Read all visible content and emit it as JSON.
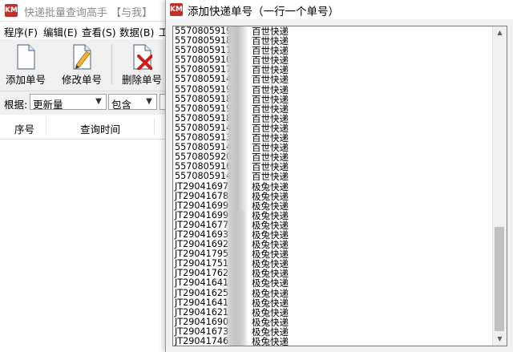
{
  "main_window": {
    "title": "快递批量查询高手 【与我】",
    "app_icon_text": "KM",
    "menu": [
      "程序(F)",
      "编辑(E)",
      "查看(S)",
      "数据(B)",
      "工"
    ],
    "toolbar": {
      "add_label": "添加单号",
      "edit_label": "修改单号",
      "delete_label": "删除单号"
    },
    "filter": {
      "label": "根据:",
      "field_value": "更新量",
      "match_value": "包含"
    },
    "table_columns": [
      "序号",
      "查询时间"
    ]
  },
  "dialog": {
    "title": "添加快递单号（一行一个单号）",
    "icon_text": "KM",
    "lines": [
      {
        "num": "5570805919",
        "carrier": "百世快递"
      },
      {
        "num": "5570805918",
        "carrier": "百世快递"
      },
      {
        "num": "5570805911",
        "carrier": "百世快递"
      },
      {
        "num": "5570805910",
        "carrier": "百世快递"
      },
      {
        "num": "5570805917",
        "carrier": "百世快递"
      },
      {
        "num": "5570805914",
        "carrier": "百世快递"
      },
      {
        "num": "5570805919",
        "carrier": "百世快递"
      },
      {
        "num": "5570805918",
        "carrier": "百世快递"
      },
      {
        "num": "5570805919",
        "carrier": "百世快递"
      },
      {
        "num": "5570805918",
        "carrier": "百世快递"
      },
      {
        "num": "5570805914",
        "carrier": "百世快递"
      },
      {
        "num": "5570805913",
        "carrier": "百世快递"
      },
      {
        "num": "5570805914",
        "carrier": "百世快递"
      },
      {
        "num": "5570805920",
        "carrier": "百世快递"
      },
      {
        "num": "5570805916",
        "carrier": "百世快递"
      },
      {
        "num": "5570805914",
        "carrier": "百世快递"
      },
      {
        "num": "JT29041697",
        "carrier": "极兔快递"
      },
      {
        "num": "JT29041678",
        "carrier": "极兔快递"
      },
      {
        "num": "JT29041699",
        "carrier": "极兔快递"
      },
      {
        "num": "JT29041699",
        "carrier": "极兔快递"
      },
      {
        "num": "JT29041677",
        "carrier": "极兔快递"
      },
      {
        "num": "JT29041693",
        "carrier": "极兔快递"
      },
      {
        "num": "JT29041692",
        "carrier": "极兔快递"
      },
      {
        "num": "JT29041795",
        "carrier": "极兔快递"
      },
      {
        "num": "JT29041751",
        "carrier": "极兔快递"
      },
      {
        "num": "JT29041762",
        "carrier": "极兔快递"
      },
      {
        "num": "JT29041641",
        "carrier": "极兔快递"
      },
      {
        "num": "JT29041625",
        "carrier": "极兔快递"
      },
      {
        "num": "JT29041641",
        "carrier": "极兔快递"
      },
      {
        "num": "JT29041621",
        "carrier": "极兔快递"
      },
      {
        "num": "JT29041690",
        "carrier": "极兔快递"
      },
      {
        "num": "JT29041673",
        "carrier": "极兔快递"
      },
      {
        "num": "JT29041746",
        "carrier": "极兔快递"
      }
    ]
  },
  "colors": {
    "icon_red": "#c0302b",
    "window_bg": "#f0f0f0",
    "scroll_thumb": "#c1c1c1"
  }
}
